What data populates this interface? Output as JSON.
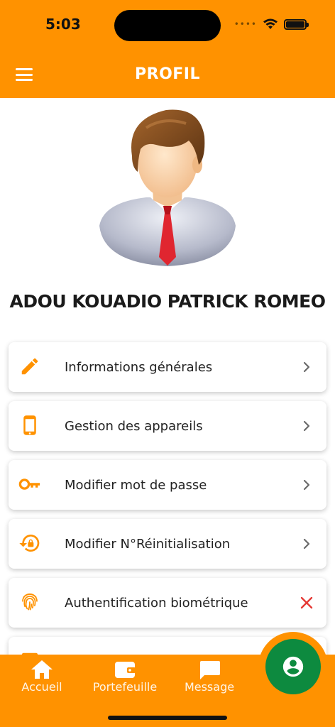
{
  "status_bar": {
    "time": "5:03",
    "signal_dots": "••••"
  },
  "header": {
    "title": "PROFIL",
    "menu_icon": "hamburger-menu-icon"
  },
  "profile": {
    "name": "ADOU KOUADIO PATRICK ROMEO",
    "avatar_icon": "businessman-avatar"
  },
  "menu": {
    "items": [
      {
        "label": "Informations générales",
        "icon": "pencil-icon",
        "action": "chevron-right-icon"
      },
      {
        "label": "Gestion des appareils",
        "icon": "smartphone-icon",
        "action": "chevron-right-icon"
      },
      {
        "label": "Modifier mot de passe",
        "icon": "key-icon",
        "action": "chevron-right-icon"
      },
      {
        "label": "Modifier N°Réinitialisation",
        "icon": "lock-reset-icon",
        "action": "chevron-right-icon"
      },
      {
        "label": "Authentification biométrique",
        "icon": "fingerprint-icon",
        "action": "close-icon"
      }
    ]
  },
  "bottom_nav": {
    "items": [
      {
        "label": "Accueil",
        "icon": "home-icon"
      },
      {
        "label": "Portefeuille",
        "icon": "wallet-icon"
      },
      {
        "label": "Message",
        "icon": "chat-icon"
      }
    ],
    "fab_icon": "account-circle-icon"
  },
  "colors": {
    "primary": "#FF9200",
    "fab": "#0D8A3F",
    "close_red": "#E53935",
    "chevron": "#6b6b6b"
  }
}
